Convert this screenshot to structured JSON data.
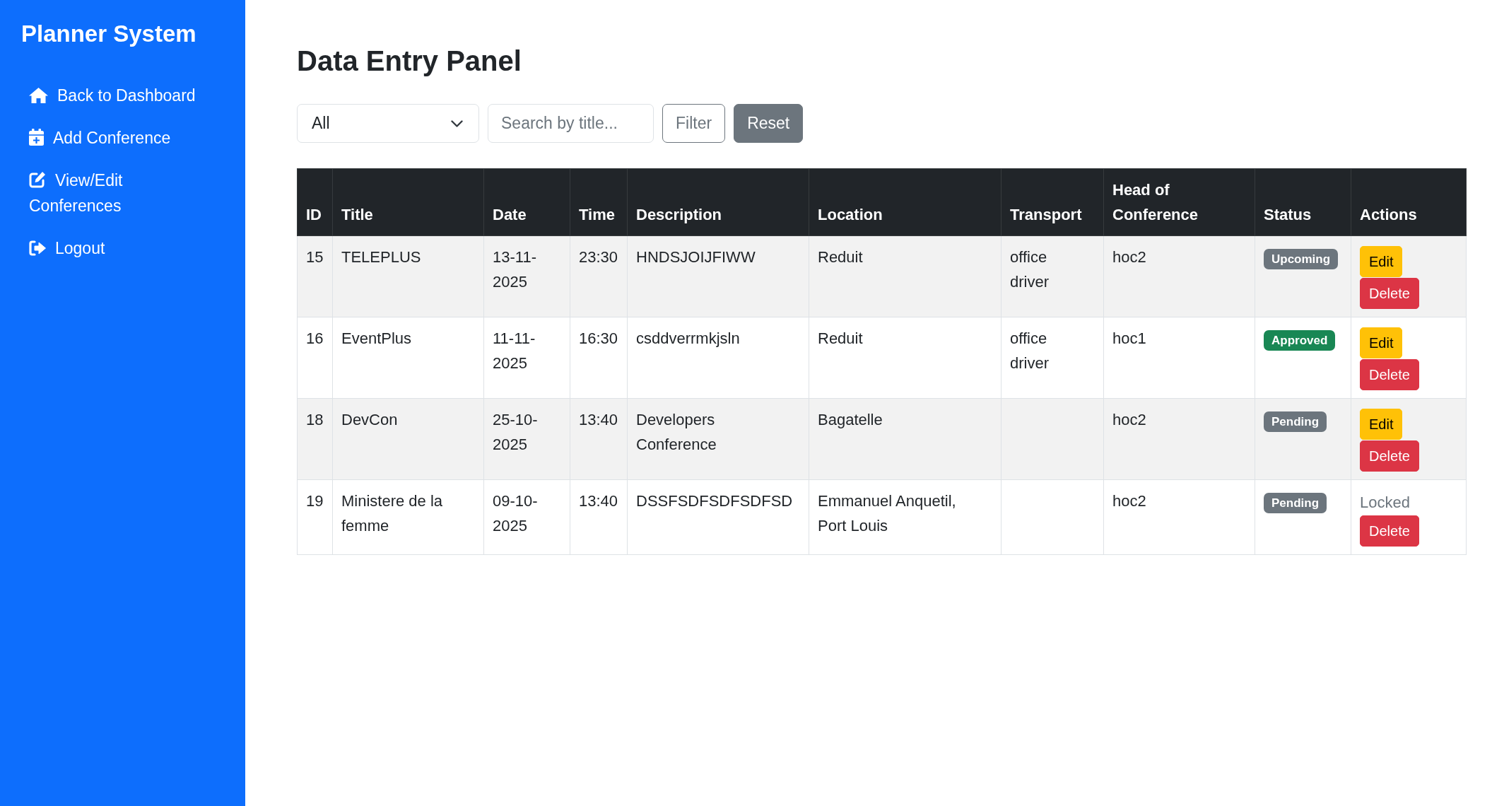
{
  "sidebar": {
    "title": "Planner System",
    "items": [
      {
        "label": "Back to Dashboard"
      },
      {
        "label": "Add Conference"
      },
      {
        "label": "View/Edit Conferences"
      },
      {
        "label": "Logout"
      }
    ]
  },
  "page_title": "Data Entry Panel",
  "filters": {
    "select": {
      "value": "All"
    },
    "search": {
      "placeholder": "Search by title..."
    },
    "buttons": [
      {
        "kind": "filter",
        "label": "Filter"
      },
      {
        "kind": "reset",
        "label": "Reset"
      }
    ]
  },
  "table": {
    "columns": [
      "ID",
      "Title",
      "Date",
      "Time",
      "Description",
      "Location",
      "Transport",
      "Head of Conference",
      "Status",
      "Actions"
    ],
    "rows": [
      {
        "id": "15",
        "title": "TELEPLUS",
        "date": "13-11-2025",
        "time": "23:30",
        "description": "HNDSJOIJFIWW",
        "location": "Reduit",
        "transport": "office driver",
        "head_of_conference": "hoc2",
        "status": {
          "label": "Upcoming",
          "color": "#6c757d"
        },
        "actions": [
          {
            "kind": "edit",
            "label": "Edit"
          },
          {
            "kind": "delete",
            "label": "Delete"
          }
        ]
      },
      {
        "id": "16",
        "title": "EventPlus",
        "date": "11-11-2025",
        "time": "16:30",
        "description": "csddverrmkjsln",
        "location": "Reduit",
        "transport": "office driver",
        "head_of_conference": "hoc1",
        "status": {
          "label": "Approved",
          "color": "#198754"
        },
        "actions": [
          {
            "kind": "edit",
            "label": "Edit"
          },
          {
            "kind": "delete",
            "label": "Delete"
          }
        ]
      },
      {
        "id": "18",
        "title": "DevCon",
        "date": "25-10-2025",
        "time": "13:40",
        "description": "Developers Conference",
        "location": "Bagatelle",
        "head_of_conference": "hoc2",
        "status": {
          "label": "Pending",
          "color": "#6c757d"
        },
        "actions": [
          {
            "kind": "edit",
            "label": "Edit"
          },
          {
            "kind": "delete",
            "label": "Delete"
          }
        ]
      },
      {
        "id": "19",
        "title": "Ministere de la femme",
        "date": "09-10-2025",
        "time": "13:40",
        "description": "DSSFSDFSDFSDFSD",
        "location": "Emmanuel Anquetil, Port Louis",
        "head_of_conference": "hoc2",
        "status": {
          "label": "Pending",
          "color": "#6c757d"
        },
        "actions": [
          {
            "kind": "locked",
            "label": "Locked"
          },
          {
            "kind": "delete",
            "label": "Delete"
          }
        ]
      }
    ]
  }
}
